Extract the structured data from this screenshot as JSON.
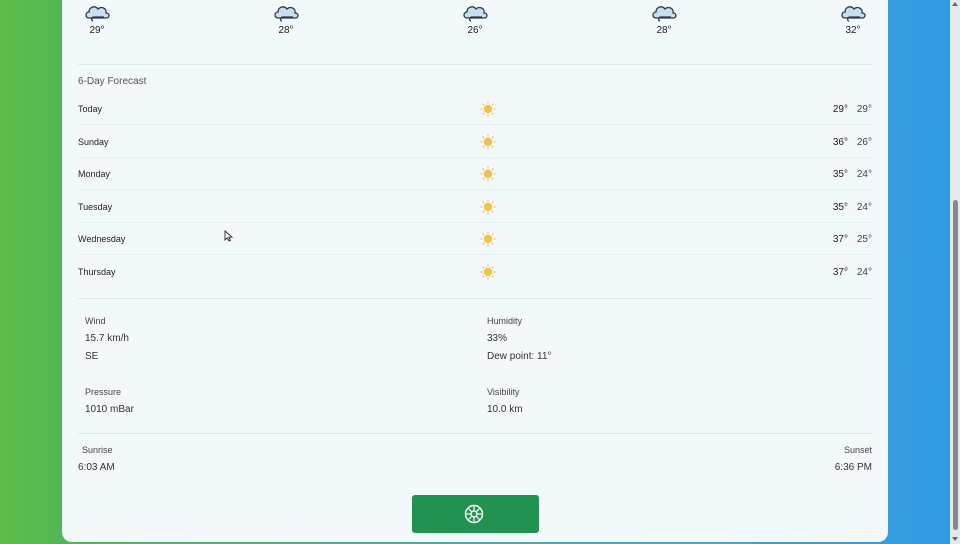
{
  "hourly": [
    {
      "temp": "29°",
      "icon": "cloud-icon"
    },
    {
      "temp": "28°",
      "icon": "cloud-icon"
    },
    {
      "temp": "26°",
      "icon": "cloud-icon"
    },
    {
      "temp": "28°",
      "icon": "cloud-icon"
    },
    {
      "temp": "32°",
      "icon": "cloud-icon"
    }
  ],
  "forecast": {
    "title": "6-Day Forecast",
    "days": [
      {
        "day": "Today",
        "hi": "29°",
        "lo": "29°",
        "icon": "sun-icon"
      },
      {
        "day": "Sunday",
        "hi": "36°",
        "lo": "26°",
        "icon": "sun-icon"
      },
      {
        "day": "Monday",
        "hi": "35°",
        "lo": "24°",
        "icon": "sun-icon"
      },
      {
        "day": "Tuesday",
        "hi": "35°",
        "lo": "24°",
        "icon": "sun-icon"
      },
      {
        "day": "Wednesday",
        "hi": "37°",
        "lo": "25°",
        "icon": "sun-icon"
      },
      {
        "day": "Thursday",
        "hi": "37°",
        "lo": "24°",
        "icon": "sun-icon"
      }
    ]
  },
  "details": {
    "wind": {
      "label": "Wind",
      "value": "15.7 km/h",
      "direction": "SE"
    },
    "humidity": {
      "label": "Humidity",
      "value": "33%",
      "dew_point": "Dew point: 11°"
    },
    "pressure": {
      "label": "Pressure",
      "value": "1010 mBar"
    },
    "visibility": {
      "label": "Visibility",
      "value": "10.0 km"
    }
  },
  "sun": {
    "sunrise_label": "Sunrise",
    "sunrise": "6:03 AM",
    "sunset_label": "Sunset",
    "sunset": "6:36 PM"
  },
  "colors": {
    "accent": "#239150",
    "sun": "#f2c14e",
    "cloud": "#c9dff0"
  }
}
